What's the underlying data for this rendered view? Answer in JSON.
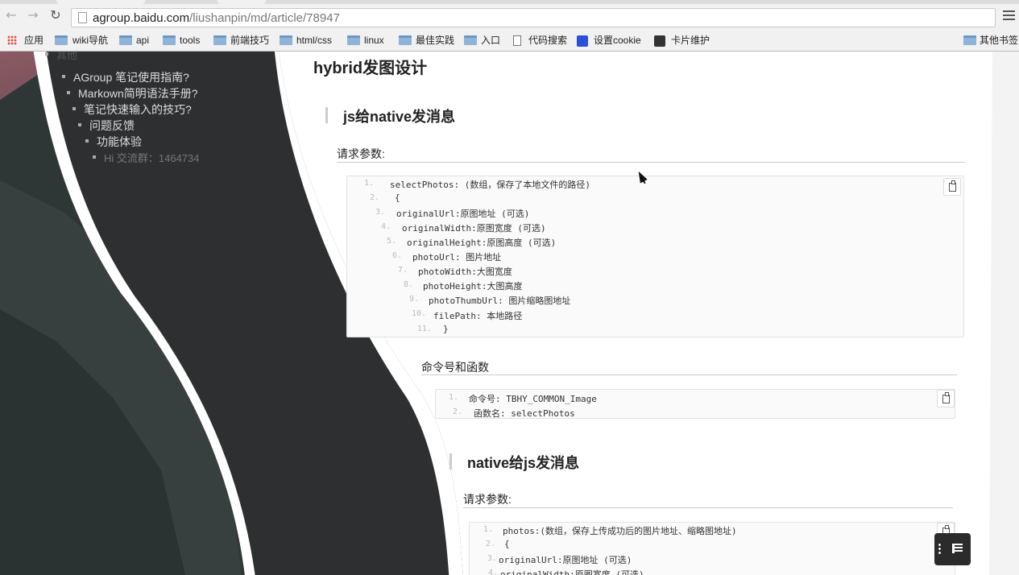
{
  "browser": {
    "url_host": "agroup.baidu.com",
    "url_path": "/liushanpin/md/article/78947",
    "back_icon": "←",
    "forward_icon": "→",
    "reload_icon": "↻"
  },
  "bookmarks": [
    {
      "label": "应用",
      "icon": "apps-icon"
    },
    {
      "label": "wiki导航",
      "icon": "folder-icon"
    },
    {
      "label": "api",
      "icon": "folder-icon"
    },
    {
      "label": "tools",
      "icon": "folder-icon"
    },
    {
      "label": "前端技巧",
      "icon": "folder-icon"
    },
    {
      "label": "html/css",
      "icon": "folder-icon"
    },
    {
      "label": "linux",
      "icon": "folder-icon"
    },
    {
      "label": "最佳实践",
      "icon": "folder-icon"
    },
    {
      "label": "入口",
      "icon": "folder-icon"
    },
    {
      "label": "代码搜索",
      "icon": "page-icon"
    },
    {
      "label": "设置cookie",
      "icon": "paw-icon"
    },
    {
      "label": "卡片维护",
      "icon": "triangle-icon"
    },
    {
      "label": "其他书签",
      "icon": "folder-icon"
    }
  ],
  "toc": {
    "faded_label": "其他",
    "items": [
      "AGroup 笔记使用指南?",
      "Markown简明语法手册?",
      "笔记快速输入的技巧?",
      "问题反馈",
      "功能体验",
      "Hi 交流群：1464734"
    ]
  },
  "article": {
    "title": "hybrid发图设计",
    "section1": "js给native发消息",
    "params_label": "请求参数:",
    "code1": [
      "selectPhotos: (数组，保存了本地文件的路径)",
      "{",
      "    originalUrl:原图地址 (可选)",
      "    originalWidth:原图宽度 (可选)",
      "    originalHeight:原图高度 (可选)",
      "    photoUrl: 图片地址",
      "    photoWidth:大图宽度",
      "    photoHeight:大图高度",
      "    photoThumbUrl: 图片缩略图地址",
      "    filePath: 本地路径",
      "}"
    ],
    "cmd_label": "命令号和函数",
    "code2": [
      "命令号: TBHY_COMMON_Image",
      "函数名: selectPhotos"
    ],
    "section2": "native给js发消息",
    "params_label2": "请求参数:",
    "code3": [
      "photos:(数组，保存上传成功后的图片地址、缩略图地址)",
      "{",
      "    originalUrl:原图地址 (可选)",
      "    originalWidth:原图宽度 (可选)"
    ]
  },
  "line_numbers": [
    "1.",
    "2.",
    "3.",
    "4.",
    "5.",
    "6.",
    "7.",
    "8.",
    "9.",
    "10.",
    "11."
  ]
}
